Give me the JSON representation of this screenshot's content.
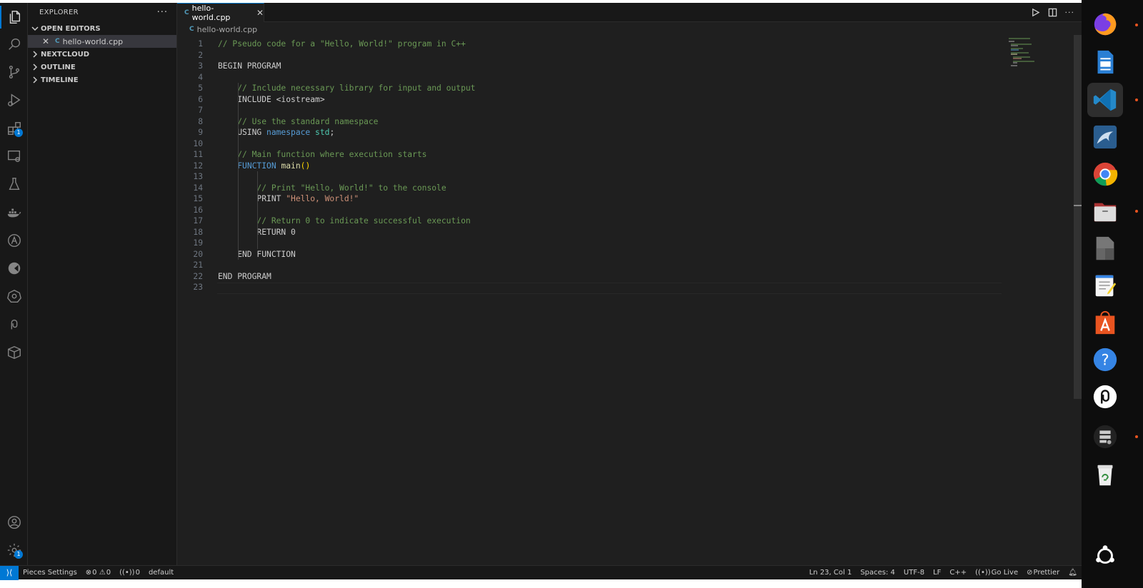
{
  "explorer": {
    "title": "EXPLORER",
    "more": "···",
    "open_editors_label": "OPEN EDITORS",
    "open_file": "hello-world.cpp",
    "sections": [
      "NEXTCLOUD",
      "OUTLINE",
      "TIMELINE"
    ]
  },
  "activity_bar": {
    "extensions_badge": "1",
    "settings_badge": "1"
  },
  "tab": {
    "label": "hello-world.cpp",
    "file_icon": "C"
  },
  "breadcrumb": {
    "file": "hello-world.cpp",
    "file_icon": "C"
  },
  "editor": {
    "language": "cpp",
    "lines": [
      "// Pseudo code for a \"Hello, World!\" program in C++",
      "",
      "BEGIN PROGRAM",
      "",
      "    // Include necessary library for input and output",
      "    INCLUDE <iostream>",
      "",
      "    // Use the standard namespace",
      "    USING namespace std;",
      "",
      "    // Main function where execution starts",
      "    FUNCTION main()",
      "",
      "        // Print \"Hello, World!\" to the console",
      "        PRINT \"Hello, World!\"",
      "",
      "        // Return 0 to indicate successful execution",
      "        RETURN 0",
      "",
      "    END FUNCTION",
      "",
      "END PROGRAM",
      ""
    ]
  },
  "status_bar": {
    "pieces": "Pieces Settings",
    "errors": "0",
    "warnings": "0",
    "ports": "0",
    "profile": "default",
    "position": "Ln 23, Col 1",
    "spaces": "Spaces: 4",
    "encoding": "UTF-8",
    "eol": "LF",
    "language": "C++",
    "go_live": "Go Live",
    "prettier": "Prettier"
  },
  "dock": {
    "apps": [
      "firefox-icon",
      "writer-icon",
      "vscode-icon",
      "mysql-workbench-icon",
      "chrome-icon",
      "files-icon",
      "document-viewer-icon",
      "text-editor-icon",
      "app-center-icon",
      "help-icon",
      "pieces-icon",
      "server-icon",
      "trash-icon",
      "show-apps-icon"
    ]
  },
  "colors": {
    "accent": "#0078d4",
    "comment": "#6a9955",
    "keyword": "#569cd6",
    "string": "#ce9178",
    "dock_indicator": "#e95420"
  }
}
